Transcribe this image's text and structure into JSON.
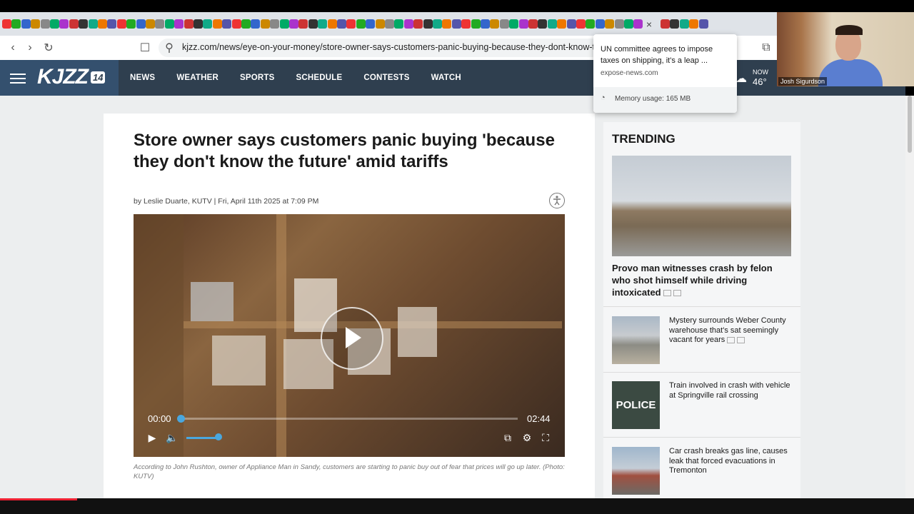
{
  "browser": {
    "url": "kjzz.com/news/eye-on-your-money/store-owner-says-customers-panic-buying-because-they-dont-know-the-fu",
    "tab_close": "×"
  },
  "site": {
    "logo_text": "KJZZ",
    "logo_number": "14",
    "nav": [
      "NEWS",
      "WEATHER",
      "SPORTS",
      "SCHEDULE",
      "CONTESTS",
      "WATCH"
    ],
    "weather_now": "NOW",
    "weather_temp": "46°"
  },
  "article": {
    "headline": "Store owner says customers panic buying 'because they don't know the future' amid tariffs",
    "byline": "by Leslie Duarte, KUTV | Fri, April 11th 2025 at 7:09 PM",
    "video": {
      "current_time": "00:00",
      "duration": "02:44",
      "progress": 0.0,
      "volume": 0.85
    },
    "caption": "According to John Rushton, owner of Appliance Man in Sandy, customers are starting to panic buy out of fear that prices will go up later. (Photo: KUTV)"
  },
  "trending": {
    "title": "TRENDING",
    "main_headline": "Provo man witnesses crash by felon who shot himself while driving intoxicated",
    "items": [
      {
        "headline": "Mystery surrounds Weber County warehouse that's sat seemingly vacant for years"
      },
      {
        "headline": "Train involved in crash with vehicle at Springville rail crossing"
      },
      {
        "headline": "Car crash breaks gas line, causes leak that forced evacuations in Tremonton"
      }
    ]
  },
  "tab_popup": {
    "title": "UN committee agrees to impose taxes on shipping, it's a leap ...",
    "domain": "expose-news.com",
    "memory": "Memory usage: 165 MB"
  },
  "webcam": {
    "name": "Josh Sigurdson"
  },
  "colors": {
    "nav_bg": "#2f3f4f",
    "accent_blue": "#4aa7de"
  }
}
